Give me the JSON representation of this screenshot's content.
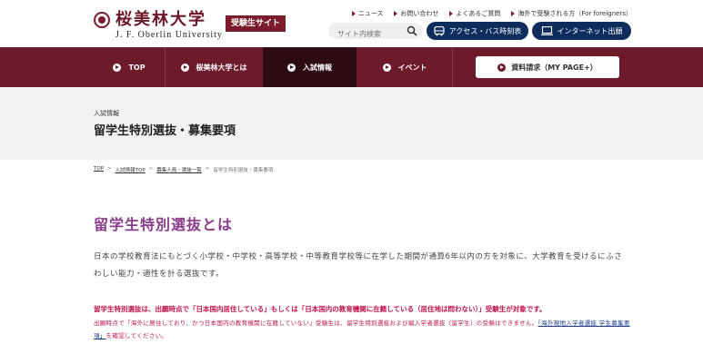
{
  "header": {
    "logo_ja": "桜美林大学",
    "logo_en": "J. F. Oberlin University",
    "exam_badge": "受験生サイト",
    "utility_links": [
      "ニュース",
      "お問い合わせ",
      "よくあるご質問",
      "海外で受験される方（For foreigners）"
    ],
    "search_placeholder": "サイト内検索",
    "access_button": "アクセス・バス時刻表",
    "internet_button": "インターネット出願"
  },
  "nav": {
    "items": [
      "TOP",
      "桜美林大学とは",
      "入試情報",
      "イベント"
    ],
    "active_index": 2,
    "mypage_button": "資料請求（MY PAGE+）"
  },
  "title_band": {
    "category": "入試情報",
    "title": "留学生特別選抜・募集要項"
  },
  "breadcrumb": [
    "TOP",
    "入試情報TOP",
    "募集人員・選抜一覧",
    "留学生特別選抜・募集要項"
  ],
  "content": {
    "heading": "留学生特別選抜とは",
    "paragraph": "日本の学校教育法にもとづく小学校・中学校・高等学校・中等教育学校等に在学した期間が通算6年以内の方を対象に、大学教育を受けるにふさわしい能力・適性を計る選抜です。",
    "note_strong": "留学生特別選抜は、出願時点で「日本国内居住している」もしくは「日本国内の教育機関に在籍している（居住地は問わない）」受験生が対象です。",
    "note_pre": "出願時点で「海外に居住しており、かつ日本国内の教育機関に在籍していない」受験生は、留学生特別選抜および編入学者選抜（留学生）の受験はできません。",
    "note_link": "「海外現地入学者選抜 学生募集要項」",
    "note_post": "を確認してください。"
  },
  "colors": {
    "brand": "#6d1a2c",
    "nav_active": "#2c0b12",
    "navy": "#0e2c5c",
    "heading_purple": "#8b3b8c",
    "alert_red": "#c0144a"
  }
}
